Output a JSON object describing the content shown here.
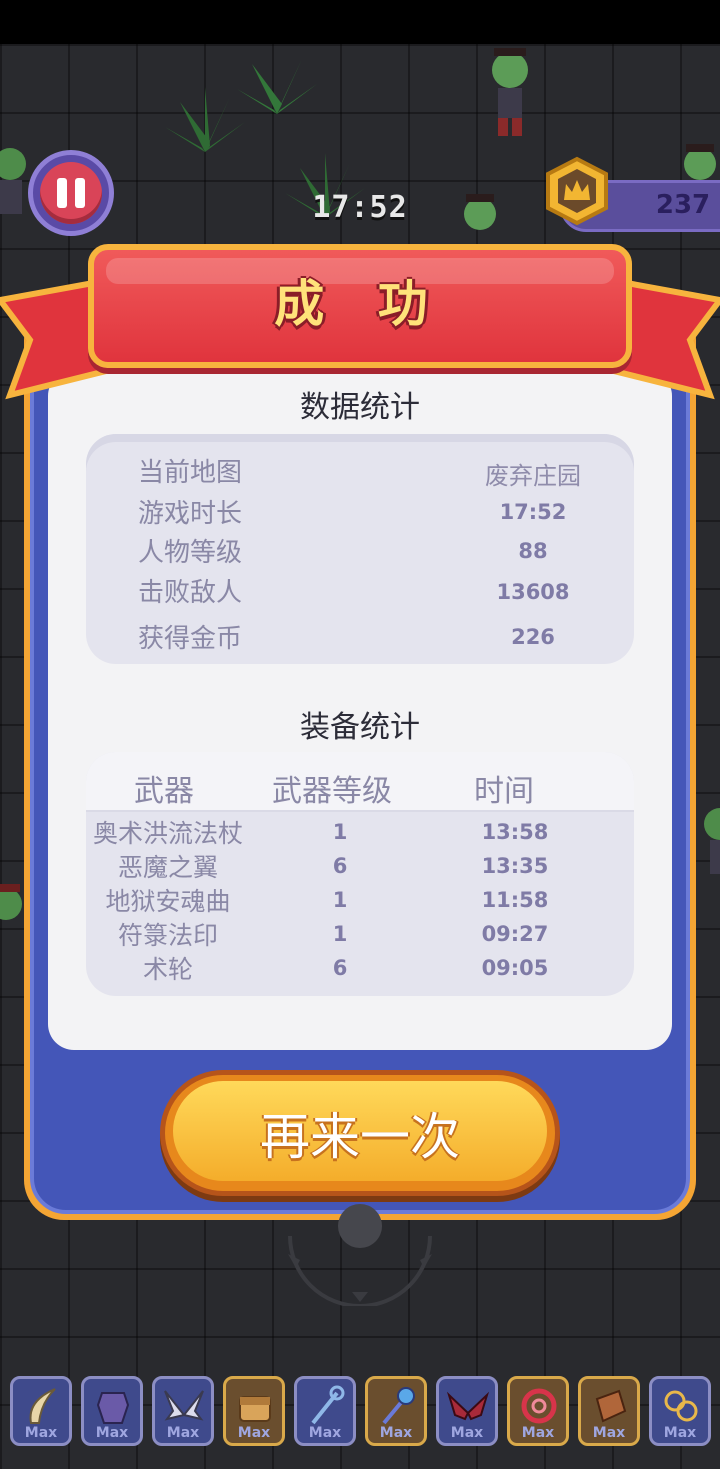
{
  "hud": {
    "timer": "17:52",
    "coins": "237"
  },
  "result": {
    "title": "成 功",
    "stats_title": "数据统计",
    "stats": [
      {
        "label": "当前地图",
        "value": "废弃庄园"
      },
      {
        "label": "游戏时长",
        "value": "17:52"
      },
      {
        "label": "人物等级",
        "value": "88"
      },
      {
        "label": "击败敌人",
        "value": "13608"
      },
      {
        "label": "获得金币",
        "value": "226"
      }
    ],
    "equip_title": "装备统计",
    "equip_headers": [
      "武器",
      "武器等级",
      "时间"
    ],
    "equipment": [
      {
        "name": "奥术洪流法杖",
        "level": "1",
        "time": "13:58"
      },
      {
        "name": "恶魔之翼",
        "level": "6",
        "time": "13:35"
      },
      {
        "name": "地狱安魂曲",
        "level": "1",
        "time": "11:58"
      },
      {
        "name": "符箓法印",
        "level": "1",
        "time": "09:27"
      },
      {
        "name": "术轮",
        "level": "6",
        "time": "09:05"
      }
    ],
    "retry_label": "再来一次"
  },
  "inventory": {
    "max_label": "Max",
    "slots": [
      {
        "icon": "claw-icon",
        "style": "blue"
      },
      {
        "icon": "armor-icon",
        "style": "blue"
      },
      {
        "icon": "wings-icon",
        "style": "blue"
      },
      {
        "icon": "chest-icon",
        "style": "gold"
      },
      {
        "icon": "staff-icon",
        "style": "blue"
      },
      {
        "icon": "wand-icon",
        "style": "gold"
      },
      {
        "icon": "demon-wings-icon",
        "style": "blue"
      },
      {
        "icon": "ring-icon",
        "style": "gold"
      },
      {
        "icon": "scroll-icon",
        "style": "gold"
      },
      {
        "icon": "chain-icon",
        "style": "blue"
      }
    ]
  }
}
